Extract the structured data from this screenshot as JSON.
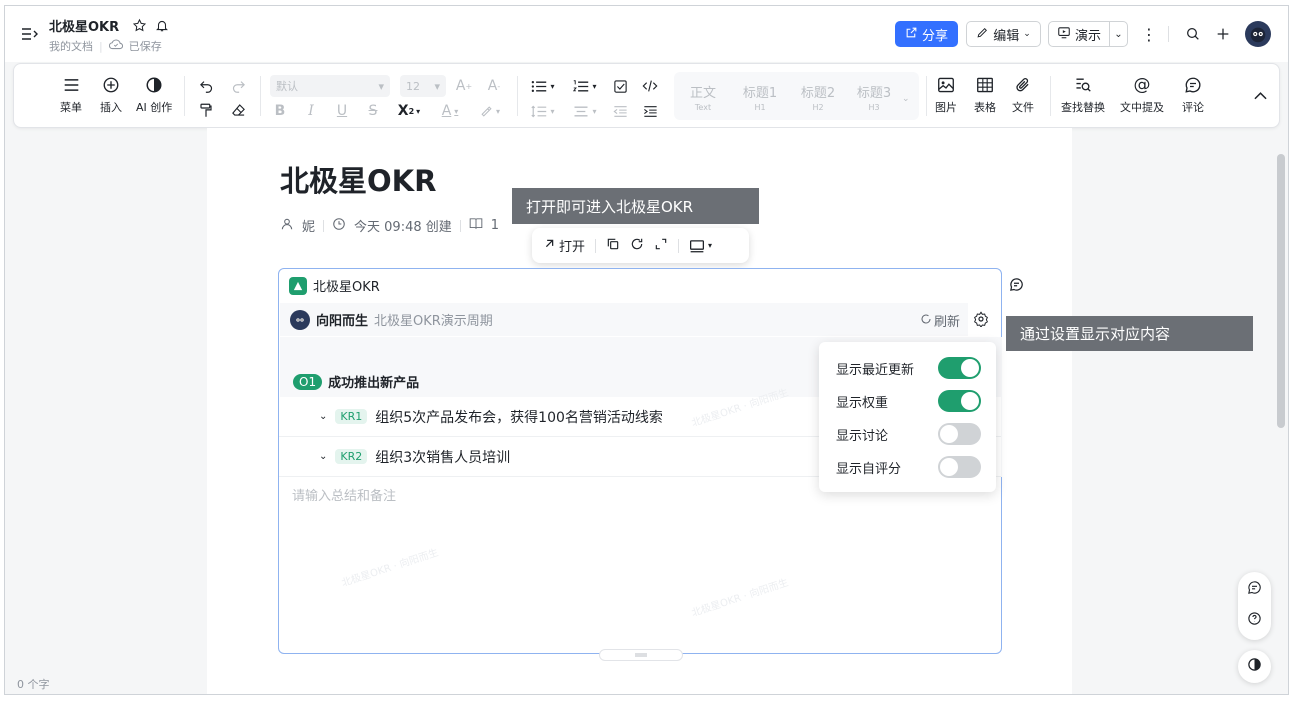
{
  "header": {
    "doc_title": "北极星OKR",
    "location": "我的文档",
    "save_status": "已保存",
    "share_label": "分享",
    "edit_label": "编辑",
    "present_label": "演示"
  },
  "toolbar": {
    "menu": "菜单",
    "insert": "插入",
    "ai": "AI 创作",
    "font_default": "默认",
    "font_size": "12",
    "styles": [
      {
        "label": "正文",
        "sub": "Text"
      },
      {
        "label": "标题1",
        "sub": "H1"
      },
      {
        "label": "标题2",
        "sub": "H2"
      },
      {
        "label": "标题3",
        "sub": "H3"
      }
    ],
    "image": "图片",
    "table": "表格",
    "file": "文件",
    "find_replace": "查找替换",
    "mention": "文中提及",
    "comment": "评论"
  },
  "doc": {
    "title": "北极星OKR",
    "author": "妮",
    "created": "今天 09:48 创建",
    "views": "1"
  },
  "tooltips": {
    "open_hint": "打开即可进入北极星OKR",
    "settings_hint": "通过设置显示对应内容"
  },
  "floatbar": {
    "open": "打开"
  },
  "card": {
    "app_name": "北极星OKR",
    "user": "向阳而生",
    "period": "北极星OKR演示周期",
    "refresh": "刷新",
    "objective_badge": "O1",
    "objective": "成功推出新产品",
    "krs": [
      {
        "badge": "KR1",
        "text": "组织5次产品发布会，获得100名营销活动线索"
      },
      {
        "badge": "KR2",
        "text": "组织3次销售人员培训"
      }
    ],
    "note_placeholder": "请输入总结和备注",
    "watermark": "北极星OKR · 向阳而生"
  },
  "settings": [
    {
      "label": "显示最近更新",
      "on": true
    },
    {
      "label": "显示权重",
      "on": true
    },
    {
      "label": "显示讨论",
      "on": false
    },
    {
      "label": "显示自评分",
      "on": false
    }
  ],
  "footer": {
    "word_count": "0 个字"
  },
  "colors": {
    "accent": "#1f6feb",
    "okr_green": "#1f9e6e"
  }
}
